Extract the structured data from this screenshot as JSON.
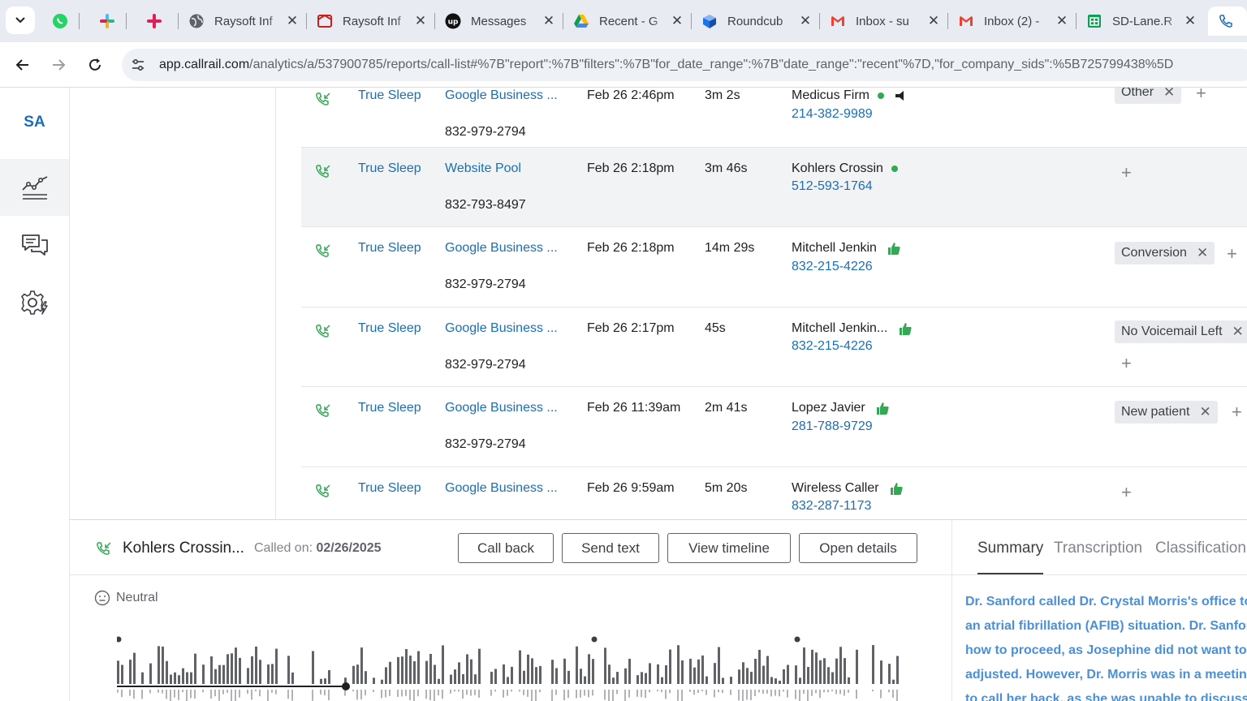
{
  "browser": {
    "tabs": [
      {
        "title": "",
        "icon": "whatsapp-icon",
        "close": ""
      },
      {
        "title": "",
        "icon": "slack-icon",
        "close": ""
      },
      {
        "title": "",
        "icon": "slack-icon",
        "close": ""
      },
      {
        "title": "Raysoft Inf",
        "icon": "globe-icon",
        "close": "✕"
      },
      {
        "title": "Raysoft Inf",
        "icon": "raysoft-icon",
        "close": "✕"
      },
      {
        "title": "Messages",
        "icon": "upwork-icon",
        "close": "✕"
      },
      {
        "title": "Recent - G",
        "icon": "google-drive-icon",
        "close": "✕"
      },
      {
        "title": "Roundcub",
        "icon": "roundcube-icon",
        "close": "✕"
      },
      {
        "title": "Inbox - su",
        "icon": "gmail-icon",
        "close": "✕"
      },
      {
        "title": "Inbox (2) -",
        "icon": "gmail-icon",
        "close": "✕"
      },
      {
        "title": "SD-Lane.R",
        "icon": "google-sheets-icon",
        "close": "✕"
      }
    ],
    "url_host": "app.callrail.com",
    "url_path": "/analytics/a/537900785/reports/call-list#%7B\"report\":%7B\"filters\":%7B\"for_date_range\":%7B\"date_range\":\"recent\"%7D,\"for_company_sids\":%5B725799438%5D"
  },
  "app": {
    "logo": "SA",
    "nav": [
      {
        "name": "analytics",
        "icon": "analytics-chart-icon"
      },
      {
        "name": "conversations",
        "icon": "chat-icon"
      },
      {
        "name": "settings",
        "icon": "gear-icon"
      }
    ]
  },
  "calls": [
    {
      "company": "True Sleep",
      "source": "Google Business ...",
      "tracking": "832-979-2794",
      "time": "Feb 26 2:46pm",
      "duration": "3m 2s",
      "caller": "Medicus Firm",
      "phone": "214-382-9989",
      "status": "green-dot",
      "tags": [
        "Other"
      ]
    },
    {
      "company": "True Sleep",
      "source": "Website Pool",
      "tracking": "832-793-8497",
      "time": "Feb 26 2:18pm",
      "duration": "3m 46s",
      "caller": "Kohlers Crossin",
      "phone": "512-593-1764",
      "status": "green-dot",
      "tags": []
    },
    {
      "company": "True Sleep",
      "source": "Google Business ...",
      "tracking": "832-979-2794",
      "time": "Feb 26 2:18pm",
      "duration": "14m 29s",
      "caller": "Mitchell Jenkin",
      "phone": "832-215-4226",
      "status": "thumbs-up",
      "tags": [
        "Conversion"
      ]
    },
    {
      "company": "True Sleep",
      "source": "Google Business ...",
      "tracking": "832-979-2794",
      "time": "Feb 26 2:17pm",
      "duration": "45s",
      "caller": "Mitchell Jenkin...",
      "phone": "832-215-4226",
      "status": "thumbs-up",
      "tags": [
        "No Voicemail Left"
      ]
    },
    {
      "company": "True Sleep",
      "source": "Google Business ...",
      "tracking": "832-979-2794",
      "time": "Feb 26 11:39am",
      "duration": "2m 41s",
      "caller": "Lopez Javier",
      "phone": "281-788-9729",
      "status": "thumbs-up",
      "tags": [
        "New patient"
      ]
    },
    {
      "company": "True Sleep",
      "source": "Google Business ...",
      "tracking": "",
      "time": "Feb 26 9:59am",
      "duration": "5m 20s",
      "caller": "Wireless Caller",
      "phone": "832-287-1173",
      "status": "thumbs-up",
      "tags": []
    }
  ],
  "plus_symbol": "+",
  "tag_remove_symbol": "✕",
  "detail": {
    "caller_name": "Kohlers Crossin...",
    "called_on_label": "Called on:",
    "called_on_date": "02/26/2025",
    "buttons": {
      "call_back": "Call back",
      "send_text": "Send text",
      "view_timeline": "View timeline",
      "open_details": "Open details"
    },
    "sentiment": "Neutral",
    "tabs": {
      "summary": "Summary",
      "transcription": "Transcription",
      "classification": "Classification"
    },
    "summary_lines": [
      "Dr. Sanford called Dr. Crystal Morris's office to d",
      "an atrial fibrillation (AFIB) situation. Dr. Sanfor",
      "how to proceed, as Josephine did not want to u",
      "adjusted. However, Dr. Morris was in a meeting",
      "to call her back, as she was unable to discuss t"
    ]
  },
  "colors": {
    "accent": "#1a6fb5",
    "summary_text": "#4a90d9",
    "positive": "#34a853"
  }
}
